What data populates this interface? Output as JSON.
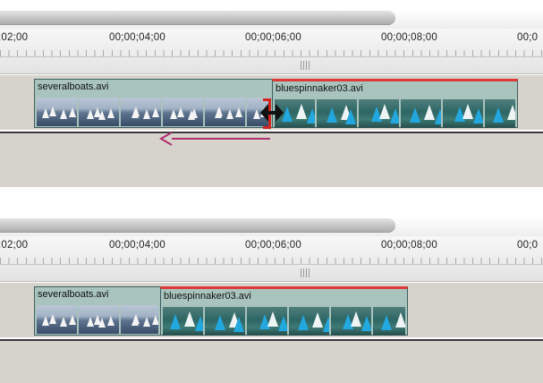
{
  "timeline_before": {
    "ruler": {
      "timecodes": [
        ";02;00",
        "00;00;04;00",
        "00;00;06;00",
        "00;00;08;00",
        "00;0"
      ]
    },
    "clips": [
      {
        "name": "severalboats.avi",
        "kind": "gray",
        "frames": 6
      },
      {
        "name": "bluespinnaker03.avi",
        "kind": "blue",
        "frames": 6
      }
    ]
  },
  "timeline_after": {
    "ruler": {
      "timecodes": [
        ";02;00",
        "00;00;04;00",
        "00;00;06;00",
        "00;00;08;00",
        "00;0"
      ]
    },
    "clips": [
      {
        "name": "severalboats.avi",
        "kind": "gray",
        "frames": 3
      },
      {
        "name": "bluespinnaker03.avi",
        "kind": "blue",
        "frames": 6
      }
    ]
  },
  "colors": {
    "track_bg": "#d6d3cd",
    "clip_bg": "#a9c3bd",
    "selection_red": "#dd3a36",
    "trim_bracket": "#d22520",
    "drag_arrow": "#b0306d"
  },
  "icons": [
    "ripple-edit-cursor-icon",
    "drag-direction-arrow-icon"
  ]
}
